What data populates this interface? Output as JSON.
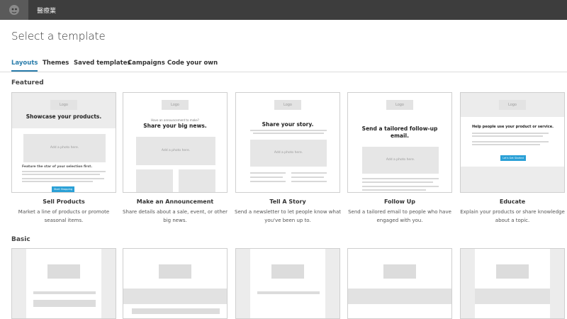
{
  "app": {
    "brand": "醫療業"
  },
  "page": {
    "title": "Select a template"
  },
  "tabs": [
    {
      "label": "Layouts",
      "active": true
    },
    {
      "label": "Themes"
    },
    {
      "label": "Saved templates"
    },
    {
      "label": "Campaigns"
    },
    {
      "label": "Code your own"
    }
  ],
  "sections": {
    "featured": "Featured",
    "basic": "Basic"
  },
  "featured": [
    {
      "name": "Sell Products",
      "desc": "Market a line of products or promote seasonal items.",
      "thumb": {
        "logo": "Logo",
        "heading": "Showcase your products.",
        "photo": "Add a photo here.",
        "sub": "Feature the star of your selection first.",
        "button": "Start Shopping"
      }
    },
    {
      "name": "Make an Announcement",
      "desc": "Share details about a sale, event, or other big news.",
      "thumb": {
        "logo": "Logo",
        "pre": "Have an announcement to make?",
        "heading": "Share your big news.",
        "photo": "Add a photo here."
      }
    },
    {
      "name": "Tell A Story",
      "desc": "Send a newsletter to let people know what you've been up to.",
      "thumb": {
        "logo": "Logo",
        "heading": "Share your story.",
        "photo": "Add a photo here."
      }
    },
    {
      "name": "Follow Up",
      "desc": "Send a tailored email to people who have engaged with you.",
      "thumb": {
        "logo": "Logo",
        "heading": "Send a tailored follow-up email.",
        "photo": "Add a photo here."
      }
    },
    {
      "name": "Educate",
      "desc": "Explain your products or share knowledge about a topic.",
      "thumb": {
        "logo": "Logo",
        "heading": "Help people use your product or service.",
        "button": "Let's Get Started"
      }
    }
  ],
  "colors": {
    "accent": "#2a7dab",
    "topbar": "#3d3d3d",
    "button": "#2aa0d6"
  }
}
